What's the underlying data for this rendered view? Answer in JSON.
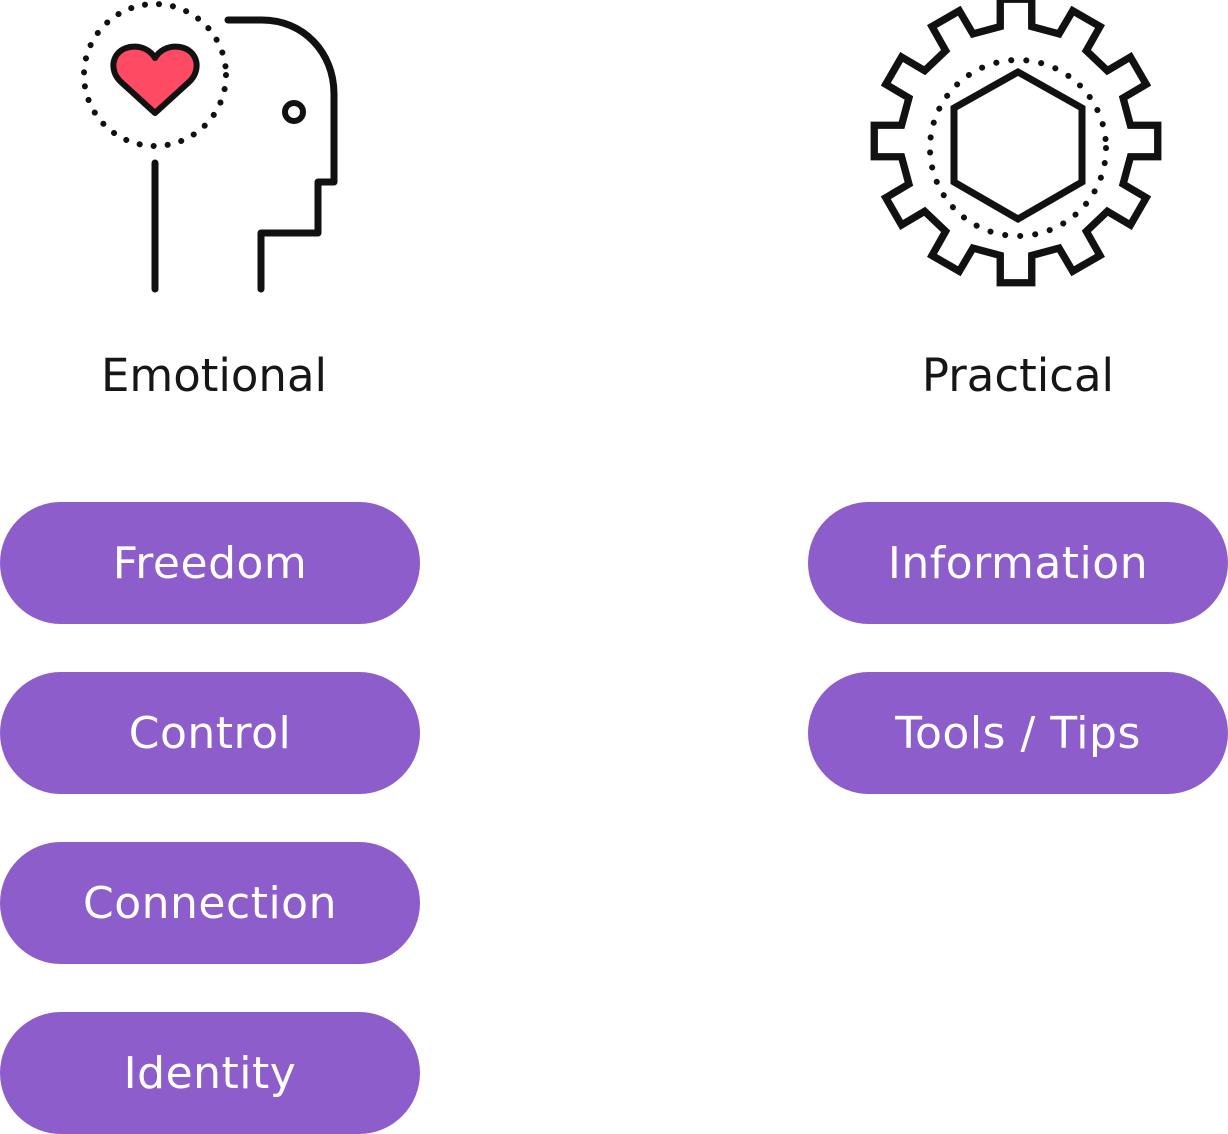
{
  "colors": {
    "pill_fill": "#8d5dcb",
    "pill_text": "#ffffff",
    "heading_text": "#161616",
    "icon_stroke": "#111111",
    "heart_fill": "#ff4a64"
  },
  "emotional": {
    "icon": "head-with-heart-icon",
    "title": "Emotional",
    "pills": [
      {
        "label": "Freedom"
      },
      {
        "label": "Control"
      },
      {
        "label": "Connection"
      },
      {
        "label": "Identity"
      }
    ]
  },
  "practical": {
    "icon": "gear-icon",
    "title": "Practical",
    "pills": [
      {
        "label": "Information"
      },
      {
        "label": "Tools / Tips"
      }
    ]
  }
}
